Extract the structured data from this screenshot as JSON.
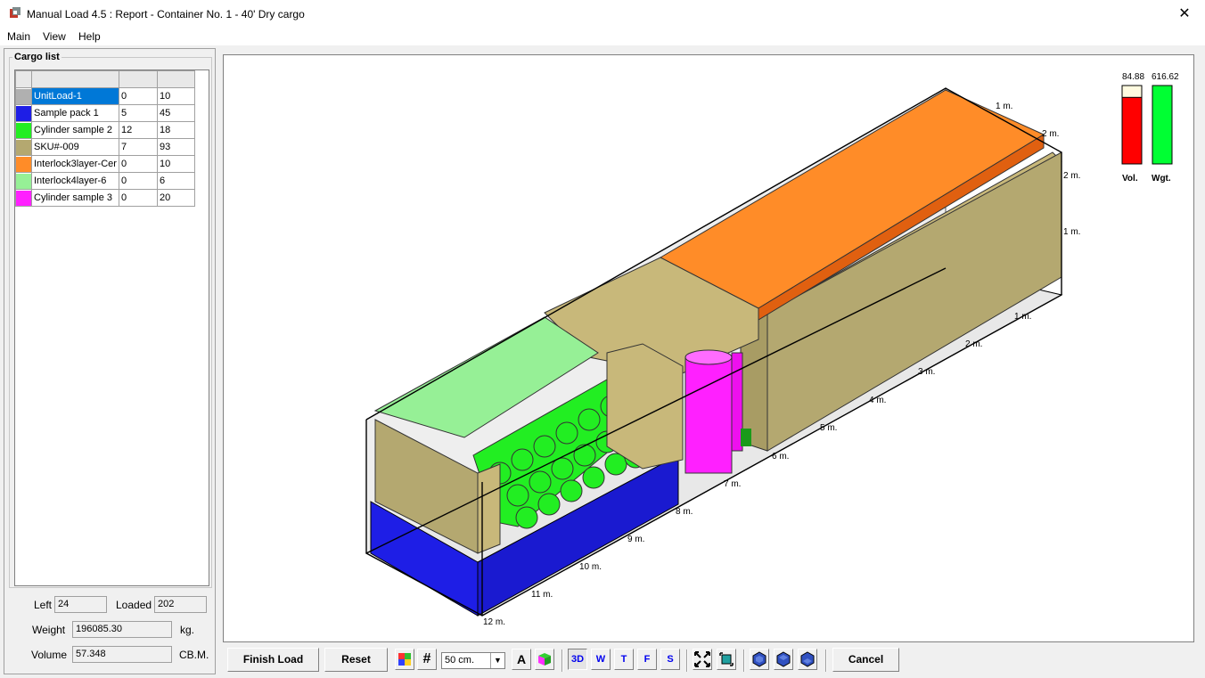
{
  "window": {
    "title": "Manual Load 4.5 : Report - Container No. 1 - 40' Dry cargo",
    "close_glyph": "✕"
  },
  "menu": [
    "Main",
    "View",
    "Help"
  ],
  "cargo_list": {
    "title": "Cargo list",
    "rows": [
      {
        "name": "UnitLoad-1",
        "c1": "0",
        "c2": "10",
        "color": "#b0b0b0"
      },
      {
        "name": "Sample pack 1",
        "c1": "5",
        "c2": "45",
        "color": "#1e1ee6"
      },
      {
        "name": "Cylinder sample 2",
        "c1": "12",
        "c2": "18",
        "color": "#22ee22"
      },
      {
        "name": "SKU#-009",
        "c1": "7",
        "c2": "93",
        "color": "#b4a870"
      },
      {
        "name": "Interlock3layer-Cer",
        "c1": "0",
        "c2": "10",
        "color": "#ff8c28"
      },
      {
        "name": "Interlock4layer-6",
        "c1": "0",
        "c2": "6",
        "color": "#96f096"
      },
      {
        "name": "Cylinder sample 3",
        "c1": "0",
        "c2": "20",
        "color": "#ff20ff"
      }
    ]
  },
  "stats": {
    "left_label": "Left",
    "left_value": "24",
    "loaded_label": "Loaded",
    "loaded_value": "202",
    "weight_label": "Weight",
    "weight_value": "196085.30",
    "weight_unit": "kg.",
    "volume_label": "Volume",
    "volume_value": "57.348",
    "volume_unit": "CB.M."
  },
  "gauges": {
    "vol_value": "84.88",
    "vol_label": "Vol.",
    "vol_fill_percent": 84.88,
    "wgt_value": "616.62",
    "wgt_label": "Wgt.",
    "wgt_fill_percent": 100
  },
  "scale_labels": {
    "top_side": [
      "1 m.",
      "2 m."
    ],
    "right_side": [
      "2 m.",
      "1 m."
    ],
    "bottom_side": [
      "1 m.",
      "2 m.",
      "3 m.",
      "4 m.",
      "5 m.",
      "6 m.",
      "7 m.",
      "8 m.",
      "9 m.",
      "10 m.",
      "11 m.",
      "12 m."
    ]
  },
  "toolbar": {
    "finish_label": "Finish Load",
    "reset_label": "Reset",
    "grid_glyph": "#",
    "scale_value": "50 cm.",
    "dropdown_glyph": "▼",
    "label_toggle": "A",
    "view_3d": "3D",
    "view_w": "W",
    "view_t": "T",
    "view_f": "F",
    "view_s": "S",
    "cancel_label": "Cancel"
  }
}
